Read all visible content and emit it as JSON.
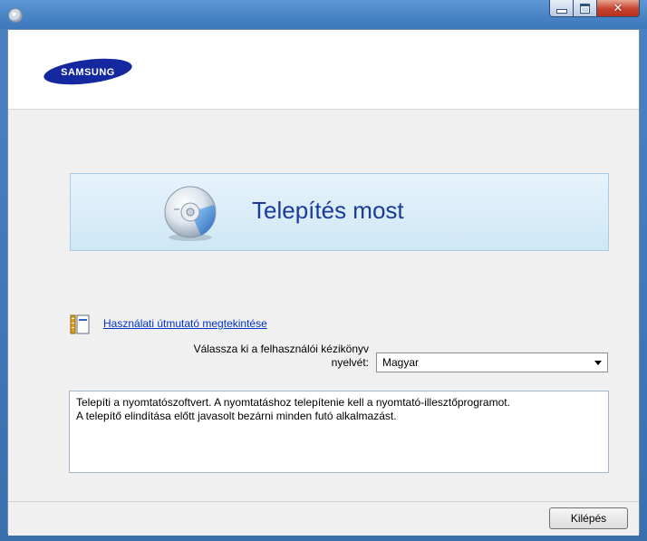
{
  "window": {
    "buttons": {
      "minimize": "minimize-icon",
      "maximize": "maximize-icon",
      "close": "close-icon"
    },
    "close_glyph": "✕"
  },
  "header": {
    "logo_text": "SAMSUNG",
    "logo_color": "#1428a0"
  },
  "install": {
    "title": "Telepítés most",
    "icon": "cd-disc-icon"
  },
  "manual": {
    "link_text": "Használati útmutató megtekintése",
    "icon": "document-icon"
  },
  "language": {
    "label_line1": "Válassza ki a felhasználói kézikönyv",
    "label_line2": "nyelvét:",
    "selected": "Magyar"
  },
  "description": {
    "line1": "Telepíti a nyomtatószoftvert. A nyomtatáshoz telepítenie kell a nyomtató-illesztőprogramot.",
    "line2": "A telepítő elindítása előtt javasolt bezárni minden futó alkalmazást."
  },
  "footer": {
    "exit_label": "Kilépés"
  },
  "colors": {
    "title_text": "#1a3a9c",
    "link": "#0033cc",
    "install_box": "#d8ecf8"
  }
}
